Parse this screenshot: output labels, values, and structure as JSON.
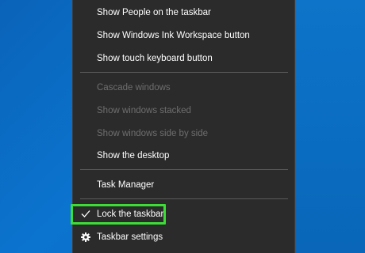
{
  "context_menu": {
    "items": [
      {
        "label": "Show People on the taskbar",
        "enabled": true
      },
      {
        "label": "Show Windows Ink Workspace button",
        "enabled": true
      },
      {
        "label": "Show touch keyboard button",
        "enabled": true
      },
      {
        "label": "Cascade windows",
        "enabled": false
      },
      {
        "label": "Show windows stacked",
        "enabled": false
      },
      {
        "label": "Show windows side by side",
        "enabled": false
      },
      {
        "label": "Show the desktop",
        "enabled": true
      },
      {
        "label": "Task Manager",
        "enabled": true
      },
      {
        "label": "Lock the taskbar",
        "enabled": true,
        "checked": true,
        "icon": "check-icon"
      },
      {
        "label": "Taskbar settings",
        "enabled": true,
        "icon": "gear-icon"
      }
    ]
  },
  "colors": {
    "menu_background": "#2b2b2b",
    "highlight_outline": "#3ddc37",
    "disabled_text": "#6e6e6e",
    "desktop_blue": "#0b74cf"
  }
}
